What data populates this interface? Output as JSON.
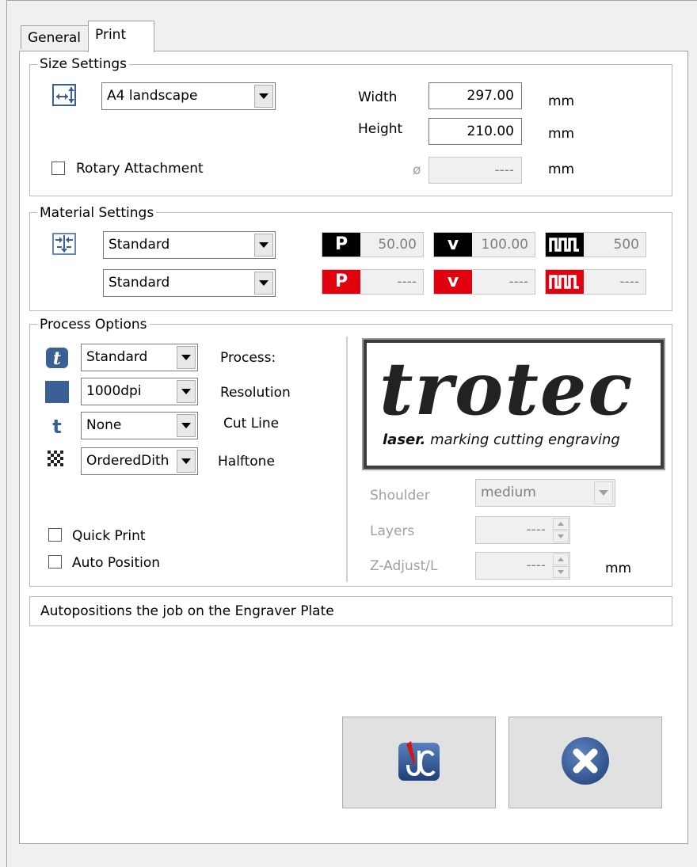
{
  "tabs": {
    "general": "General",
    "print": "Print"
  },
  "size_settings": {
    "title": "Size Settings",
    "preset": "A4 landscape",
    "width_label": "Width",
    "width_value": "297.00",
    "height_label": "Height",
    "height_value": "210.00",
    "unit": "mm",
    "rotary_label": "Rotary Attachment",
    "diameter_symbol": "ø",
    "diameter_value": "----"
  },
  "material_settings": {
    "title": "Material Settings",
    "material1": "Standard",
    "material2": "Standard",
    "row1": {
      "power_badge": "P",
      "power": "50.00",
      "velocity_badge": "v",
      "velocity": "100.00",
      "freq_badge": "ᴨᴨᴨ",
      "frequency": "500"
    },
    "row2": {
      "power_badge": "P",
      "power": "----",
      "velocity_badge": "v",
      "velocity": "----",
      "freq_badge": "ᴨᴨᴨ",
      "frequency": "----"
    },
    "colors": {
      "row1_badge": "#000000",
      "row2_badge": "#e0000e"
    }
  },
  "process_options": {
    "title": "Process Options",
    "process_value": "Standard",
    "process_label": "Process:",
    "resolution_value": "1000dpi",
    "resolution_label": "Resolution",
    "cutline_value": "None",
    "cutline_label": "Cut Line",
    "halftone_value": "OrderedDith",
    "halftone_label": "Halftone",
    "quick_print_label": "Quick Print",
    "auto_position_label": "Auto Position",
    "shoulder_label": "Shoulder",
    "shoulder_value": "medium",
    "layers_label": "Layers",
    "layers_value": "----",
    "zadjust_label": "Z-Adjust/L",
    "zadjust_value": "----",
    "zadjust_unit": "mm",
    "logo": {
      "word": "trotec",
      "tag_bold": "laser.",
      "tag_rest": " marking cutting engraving"
    }
  },
  "status_text": "Autopositions the job on the Engraver Plate",
  "buttons": {
    "ok_icon": "jobcontrol-icon",
    "cancel_icon": "close-circle-icon"
  },
  "colors": {
    "accent_blue": "#3a5f95",
    "window_bg": "#f0f0f0"
  }
}
